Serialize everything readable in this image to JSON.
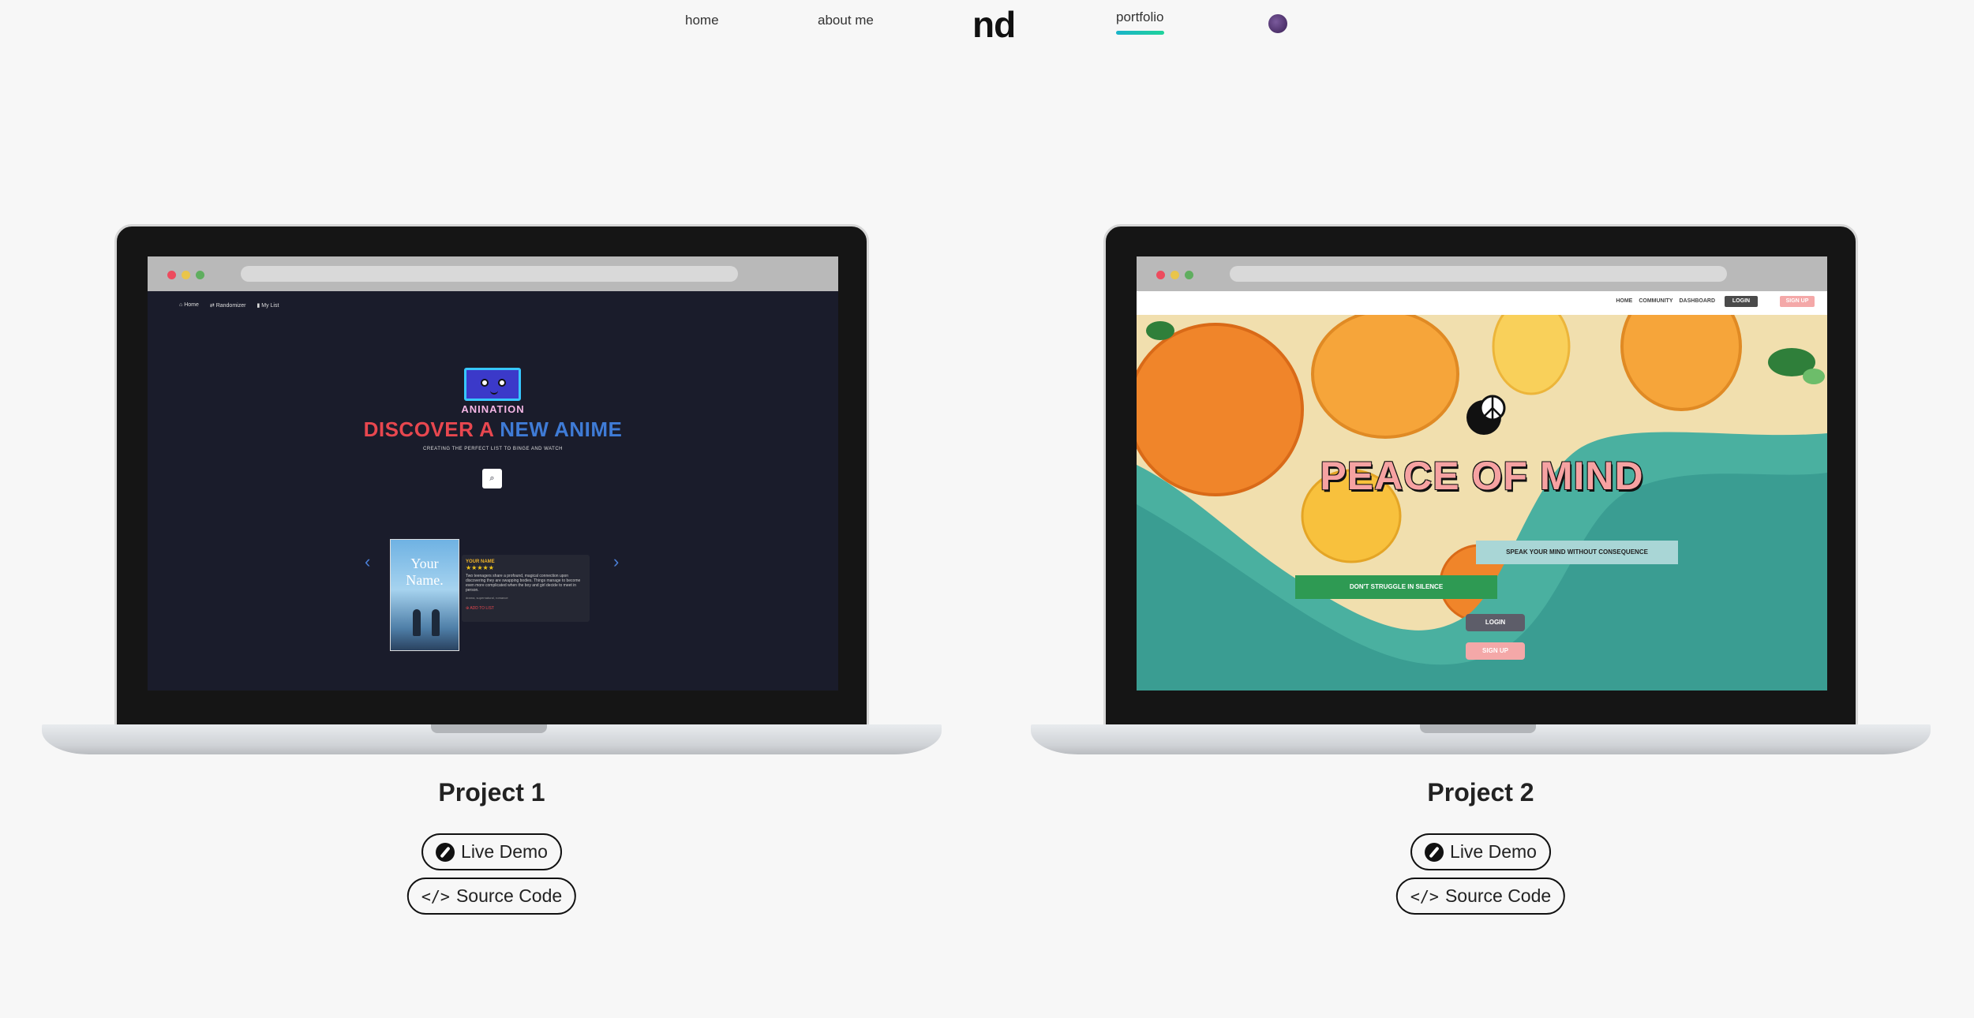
{
  "nav": {
    "home": "home",
    "about": "about me",
    "logo": "nd",
    "portfolio": "portfolio",
    "theme_icon": "theme-toggle-icon",
    "accent": "#1fd39b"
  },
  "projects": [
    {
      "title": "Project 1",
      "demo_label": "Live Demo",
      "source_label": "Source Code",
      "preview": {
        "nav": [
          "Home",
          "Randomizer",
          "My List"
        ],
        "brand": "ANINATION",
        "headline_red": "DISCOVER A ",
        "headline_blue": "NEW ANIME",
        "subtitle": "CREATING THE PERFECT LIST TO BINGE AND WATCH",
        "poster_title": "Your Name.",
        "card_title": "YOUR NAME",
        "card_stars": "★★★★★",
        "card_text": "Two teenagers share a profound, magical connection upon discovering they are swapping bodies. Things manage to become even more complicated when the boy and girl decide to meet in person.",
        "card_tags": "drama, supernatural, romance",
        "card_add": "ADD TO LIST"
      }
    },
    {
      "title": "Project 2",
      "demo_label": "Live Demo",
      "source_label": "Source Code",
      "preview": {
        "nav": [
          "HOME",
          "COMMUNITY",
          "DASHBOARD"
        ],
        "login": "LOGIN",
        "signup": "SIGN UP",
        "headline": "PEACE OF MIND",
        "box1": "SPEAK YOUR MIND WITHOUT CONSEQUENCE",
        "box2": "DON'T STRUGGLE IN SILENCE",
        "login2": "LOGIN",
        "signup2": "SIGN UP"
      }
    }
  ]
}
